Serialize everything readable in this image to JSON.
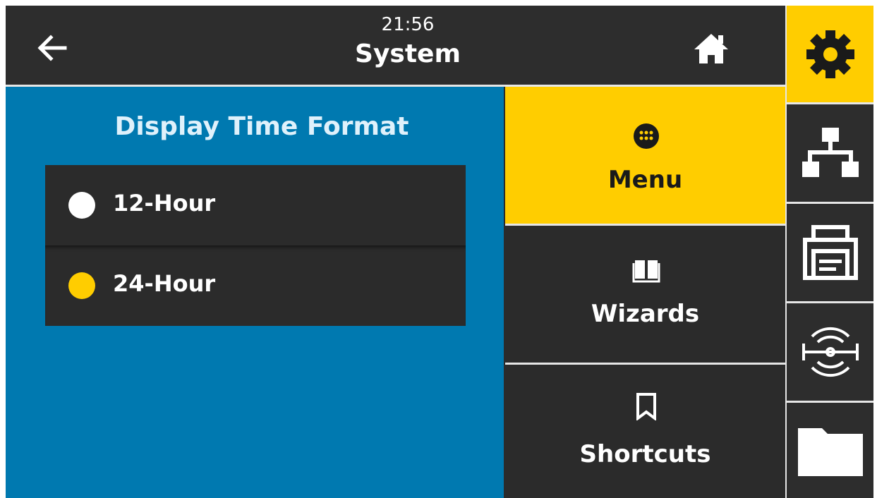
{
  "header": {
    "time": "21:56",
    "title": "System"
  },
  "content": {
    "title": "Display Time Format",
    "options": [
      {
        "label": "12-Hour",
        "selected": false
      },
      {
        "label": "24-Hour",
        "selected": true
      }
    ]
  },
  "menu": {
    "items": [
      {
        "label": "Menu",
        "icon": "menu-grid-icon",
        "active": true
      },
      {
        "label": "Wizards",
        "icon": "book-icon",
        "active": false
      },
      {
        "label": "Shortcuts",
        "icon": "bookmark-icon",
        "active": false
      }
    ]
  },
  "sidebar": {
    "items": [
      {
        "icon": "gear-icon",
        "active": true
      },
      {
        "icon": "network-icon",
        "active": false
      },
      {
        "icon": "printer-icon",
        "active": false
      },
      {
        "icon": "rfid-icon",
        "active": false
      },
      {
        "icon": "folder-icon",
        "active": false
      }
    ]
  },
  "colors": {
    "accent": "#ffcd00",
    "content_bg": "#0079b0",
    "dark_bg": "#2b2b2b",
    "radio_unselected": "#ffffff",
    "radio_selected": "#ffcd00"
  }
}
